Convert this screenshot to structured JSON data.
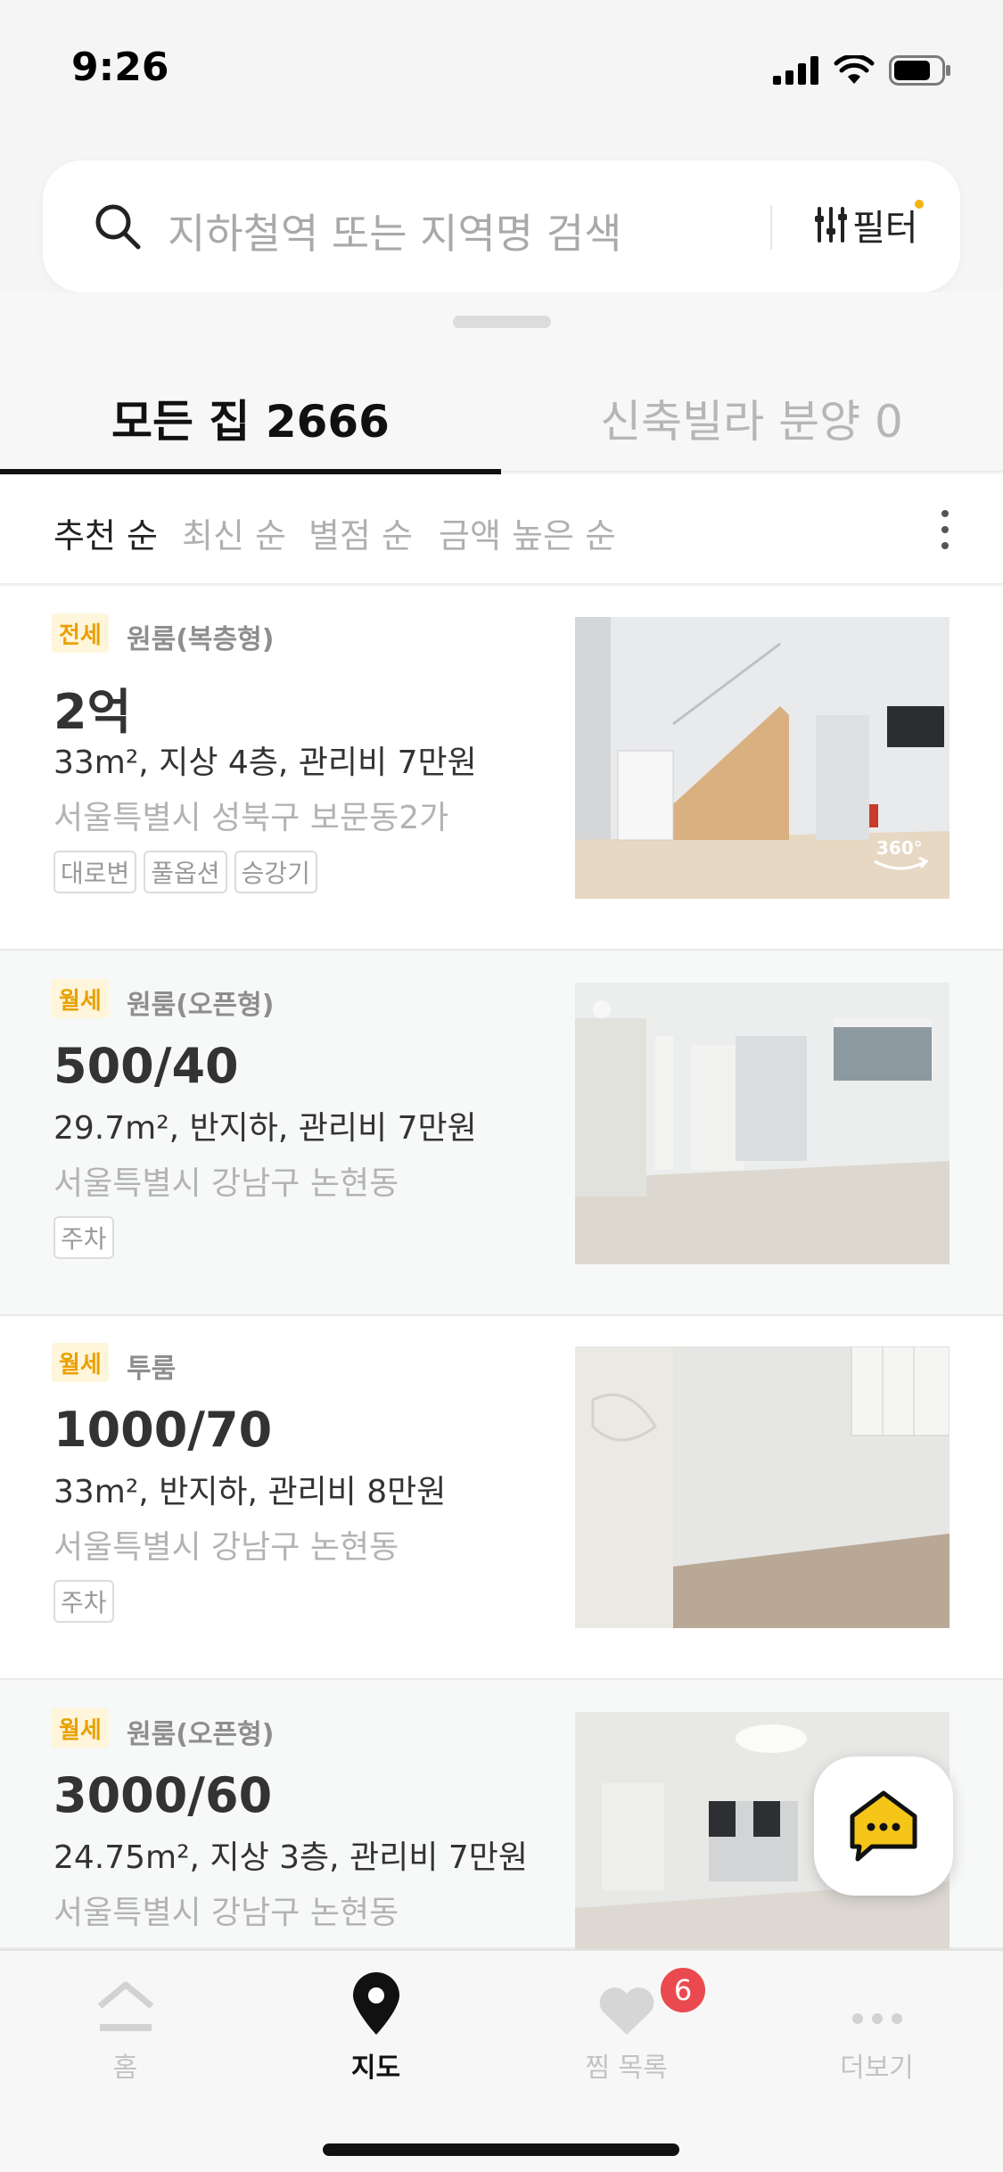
{
  "status_bar": {
    "time": "9:26"
  },
  "search": {
    "placeholder": "지하철역 또는 지역명 검색",
    "filter_label": "필터"
  },
  "tabs": [
    {
      "label": "모든 집 2666",
      "active": true
    },
    {
      "label": "신축빌라 분양 0",
      "active": false
    }
  ],
  "sort_options": [
    {
      "label": "추천 순",
      "active": true
    },
    {
      "label": "최신 순",
      "active": false
    },
    {
      "label": "별점 순",
      "active": false
    },
    {
      "label": "금액 높은 순",
      "active": false
    }
  ],
  "listings": [
    {
      "deal_type": "전세",
      "room_type": "원룸(복층형)",
      "price": "2억",
      "details": "33m², 지상 4층, 관리비 7만원",
      "address": "서울특별시 성북구 보문동2가",
      "tags": [
        "대로변",
        "풀옵션",
        "승강기"
      ],
      "has_360": true
    },
    {
      "deal_type": "월세",
      "room_type": "원룸(오픈형)",
      "price": "500/40",
      "details": "29.7m², 반지하, 관리비 7만원",
      "address": "서울특별시 강남구 논현동",
      "tags": [
        "주차"
      ],
      "has_360": false
    },
    {
      "deal_type": "월세",
      "room_type": "투룸",
      "price": "1000/70",
      "details": "33m², 반지하, 관리비 8만원",
      "address": "서울특별시 강남구 논현동",
      "tags": [
        "주차"
      ],
      "has_360": false
    },
    {
      "deal_type": "월세",
      "room_type": "원룸(오픈형)",
      "price": "3000/60",
      "details": "24.75m², 지상 3층, 관리비 7만원",
      "address": "서울특별시 강남구 논현동",
      "tags": [],
      "has_360": false
    }
  ],
  "bottom_nav": [
    {
      "label": "홈",
      "icon": "home-icon",
      "active": false
    },
    {
      "label": "지도",
      "icon": "map-pin-icon",
      "active": true
    },
    {
      "label": "찜 목록",
      "icon": "heart-icon",
      "active": false,
      "badge": "6"
    },
    {
      "label": "더보기",
      "icon": "more-icon",
      "active": false
    }
  ],
  "colors": {
    "accent": "#f2b40f",
    "badge_red": "#ea4a4f",
    "text_dark": "#222222",
    "text_muted": "#b3b3b3"
  }
}
